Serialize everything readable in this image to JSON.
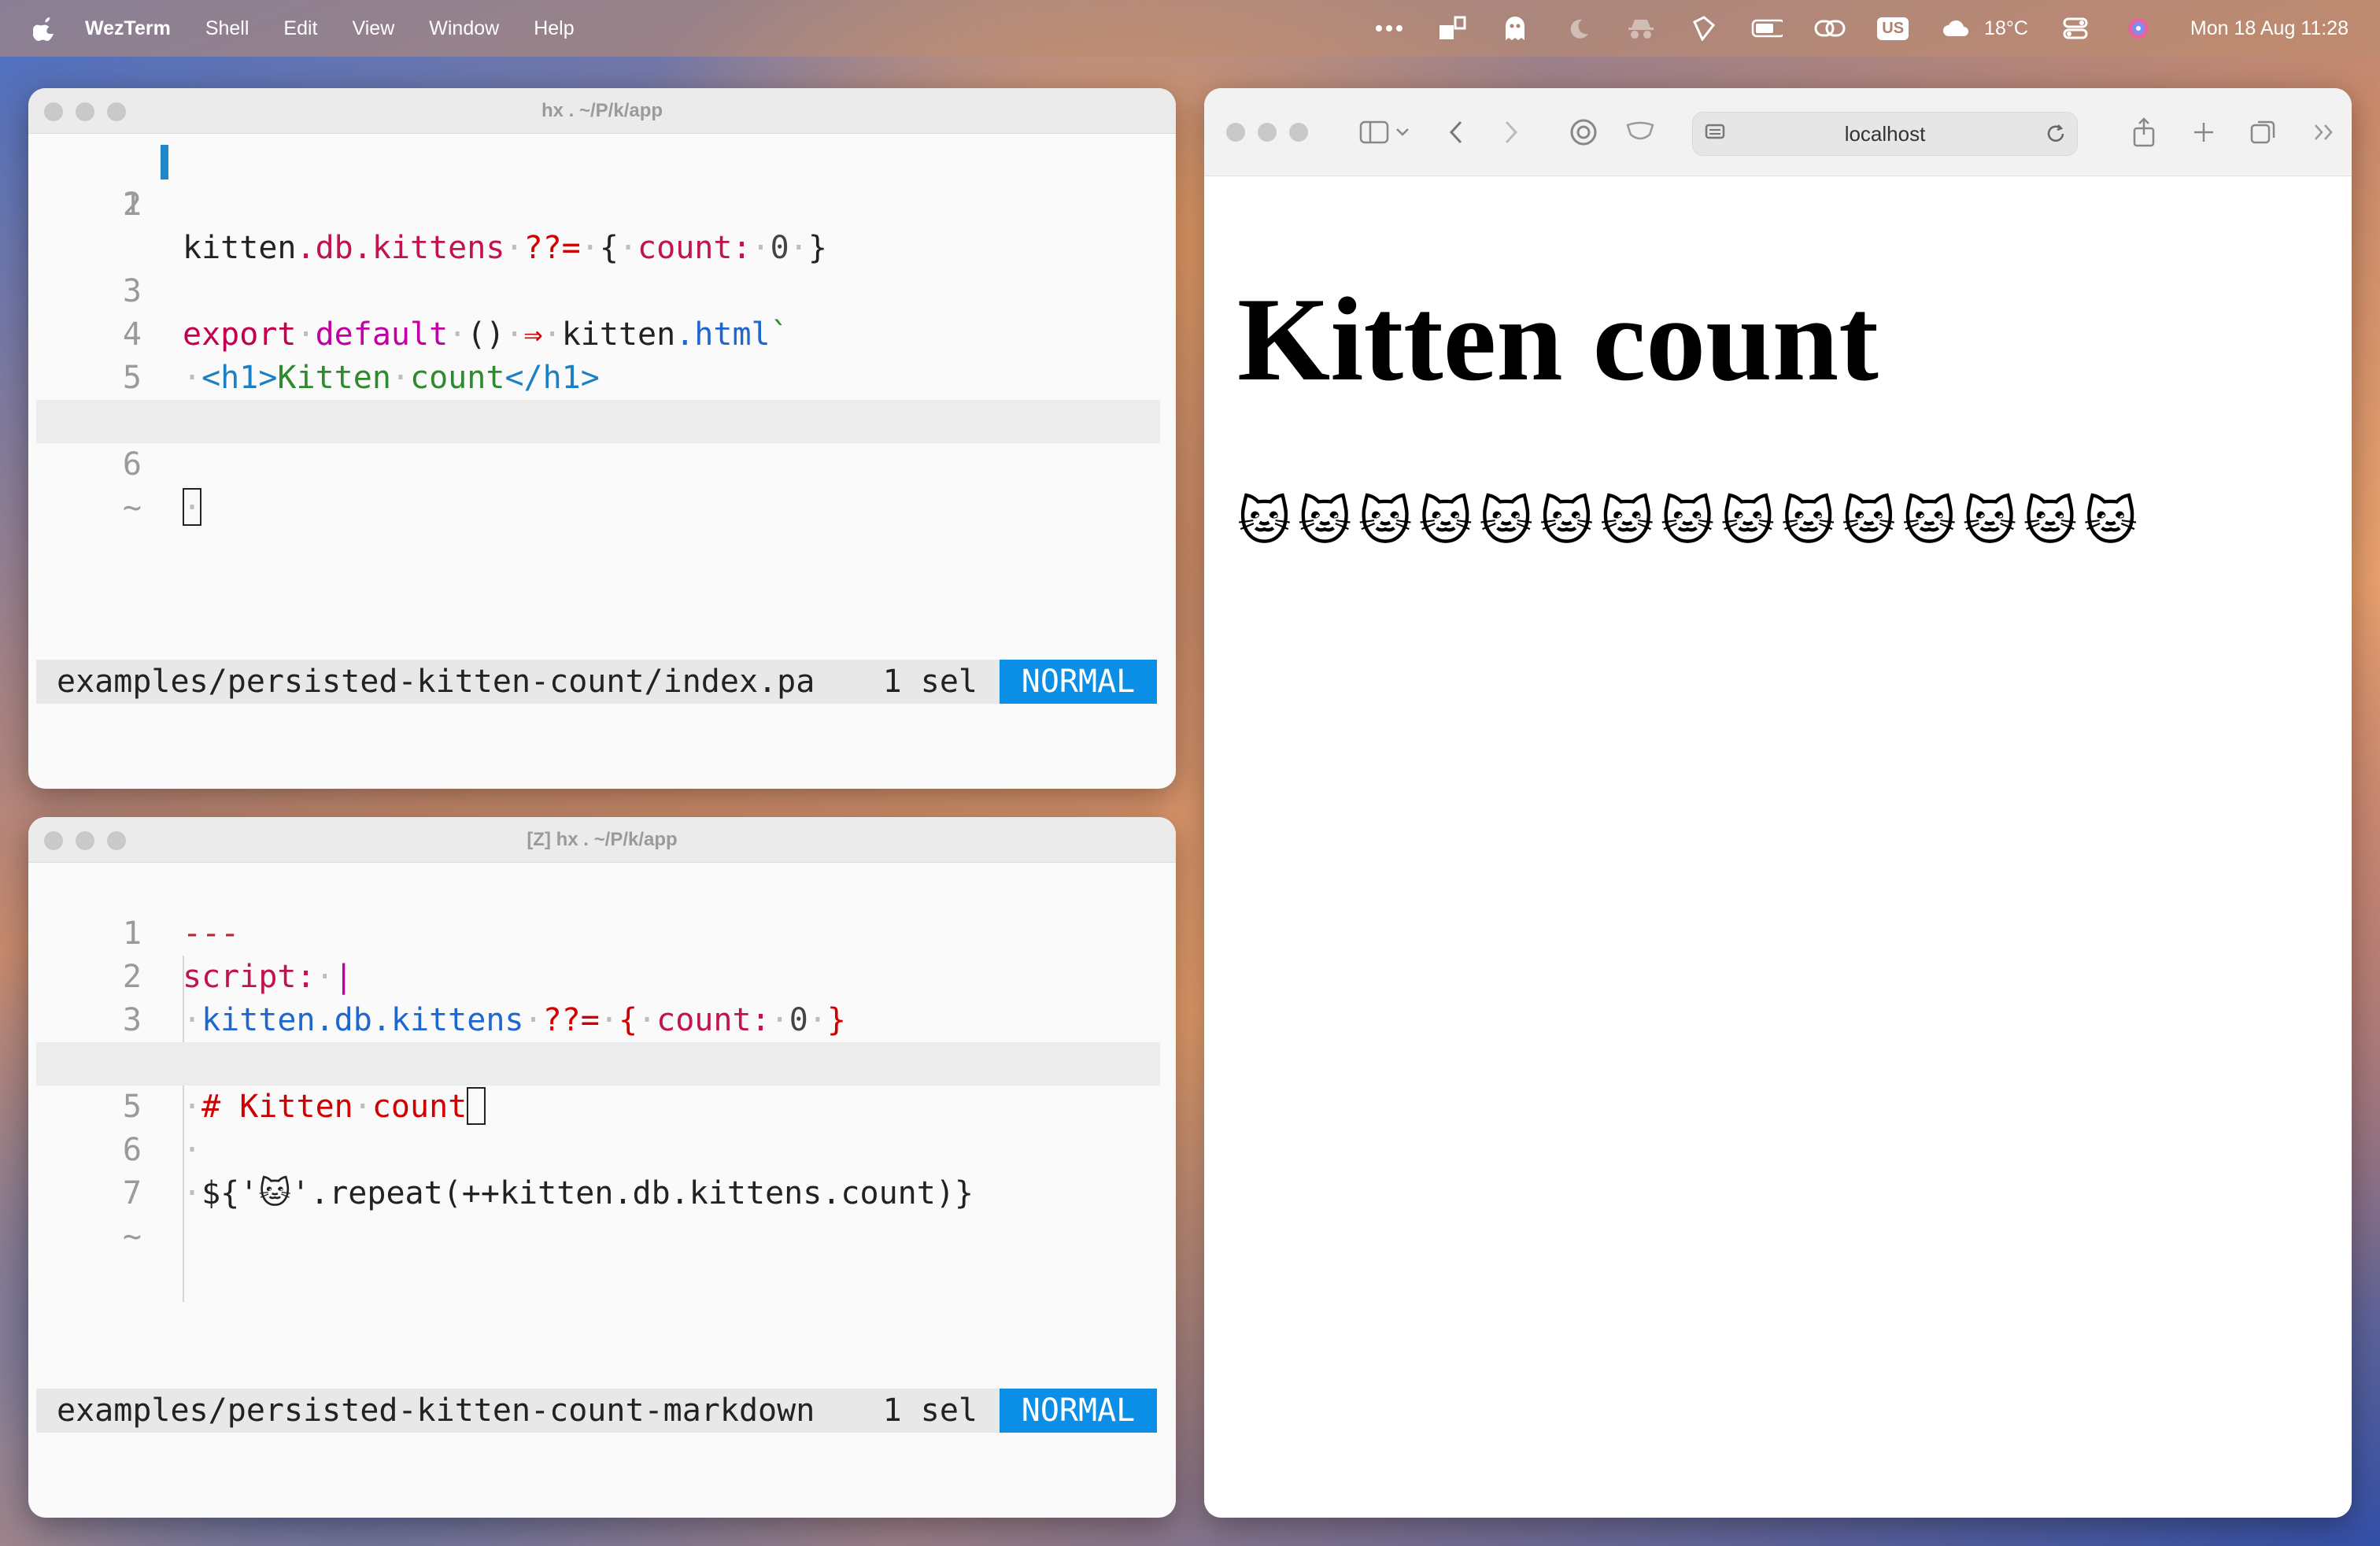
{
  "menubar": {
    "app": "WezTerm",
    "items": [
      "Shell",
      "Edit",
      "View",
      "Window",
      "Help"
    ],
    "temperature": "18°C",
    "keyboard": "US",
    "clock": "Mon 18 Aug  11:28"
  },
  "editor1": {
    "title": "hx . ~/P/k/app",
    "filepath": "examples/persisted-kitten-count/index.pa",
    "selection": "1 sel",
    "mode": "NORMAL"
  },
  "editor2": {
    "title": "[Z] hx . ~/P/k/app",
    "filepath": "examples/persisted-kitten-count-markdown",
    "selection": "1 sel",
    "mode": "NORMAL"
  },
  "browser": {
    "url": "localhost",
    "heading": "Kitten count",
    "cats": "🐱🐱🐱🐱🐱🐱🐱🐱🐱🐱🐱🐱🐱🐱🐱"
  }
}
